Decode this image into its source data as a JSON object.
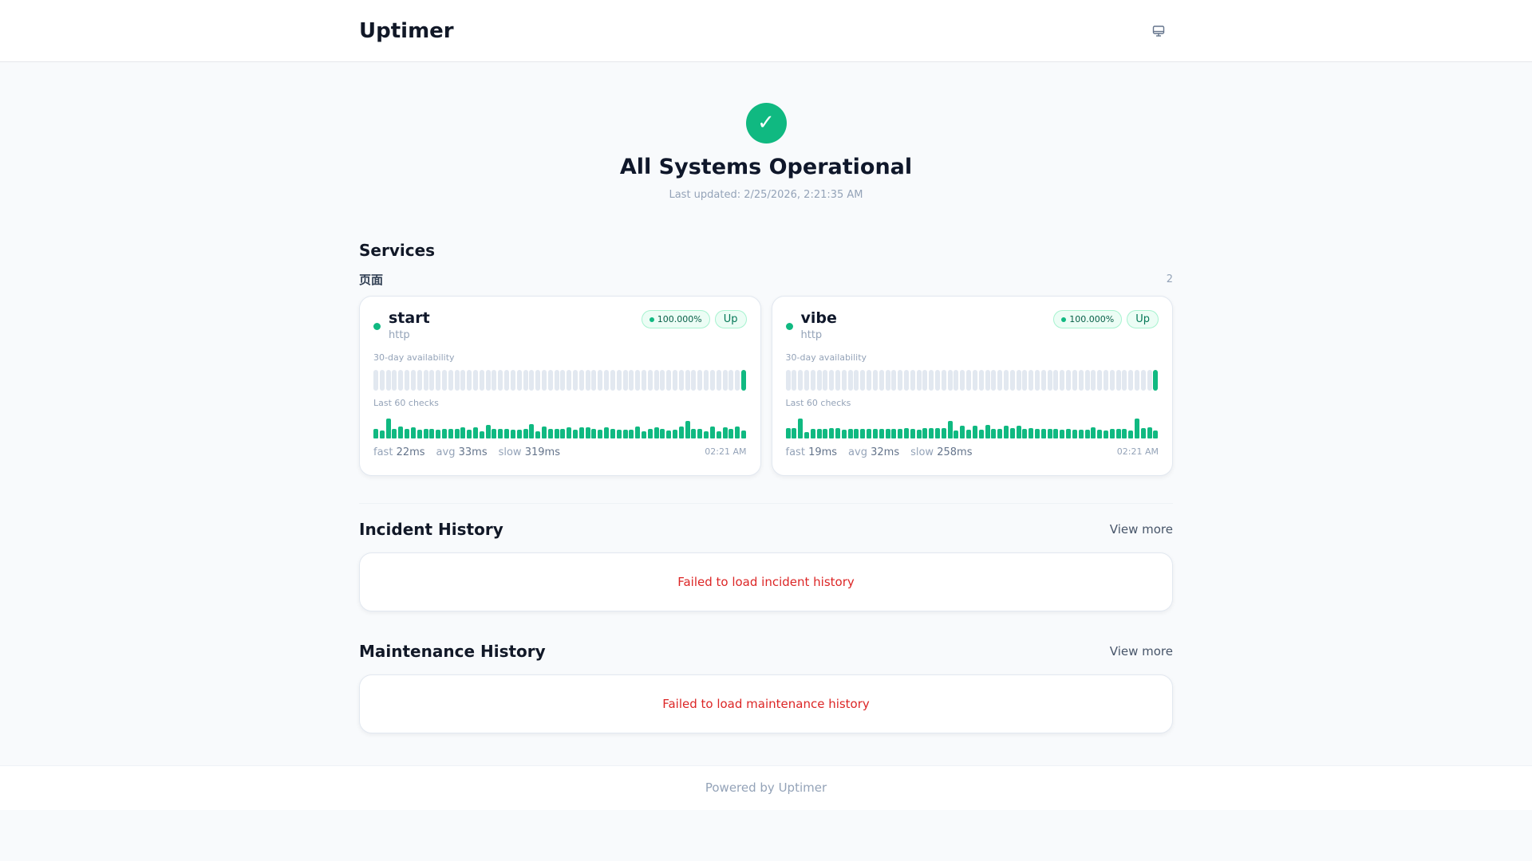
{
  "header": {
    "title": "Uptimer",
    "theme_icon": "monitor-icon"
  },
  "hero": {
    "icon": "✓",
    "title": "All Systems Operational",
    "updated": "Last updated: 2/25/2026, 2:21:35 AM"
  },
  "services": {
    "title": "Services",
    "group": {
      "name": "页面",
      "count": "2"
    },
    "cards": [
      {
        "name": "start",
        "type": "http",
        "uptime": "100.000%",
        "status": "Up",
        "avail_label": "30-day availability",
        "checks_label": "Last 60 checks",
        "availability": [
          0,
          0,
          0,
          0,
          0,
          0,
          0,
          0,
          0,
          0,
          0,
          0,
          0,
          0,
          0,
          0,
          0,
          0,
          0,
          0,
          0,
          0,
          0,
          0,
          0,
          0,
          0,
          0,
          0,
          0,
          0,
          0,
          0,
          0,
          0,
          0,
          0,
          0,
          0,
          0,
          0,
          0,
          0,
          0,
          0,
          0,
          0,
          0,
          0,
          0,
          0,
          0,
          0,
          0,
          0,
          0,
          0,
          0,
          0,
          1
        ],
        "latency": [
          30,
          23,
          60,
          30,
          35,
          30,
          33,
          27,
          30,
          30,
          27,
          30,
          28,
          28,
          33,
          27,
          33,
          22,
          42,
          28,
          30,
          28,
          27,
          27,
          30,
          44,
          22,
          37,
          30,
          30,
          28,
          33,
          27,
          33,
          33,
          28,
          27,
          33,
          28,
          27,
          27,
          27,
          37,
          22,
          28,
          33,
          28,
          25,
          27,
          35,
          53,
          28,
          30,
          22,
          35,
          22,
          33,
          28,
          35,
          23
        ],
        "fast_label": "fast",
        "fast": "22ms",
        "avg_label": "avg",
        "avg": "33ms",
        "slow_label": "slow",
        "slow": "319ms",
        "time": "02:21 AM"
      },
      {
        "name": "vibe",
        "type": "http",
        "uptime": "100.000%",
        "status": "Up",
        "avail_label": "30-day availability",
        "checks_label": "Last 60 checks",
        "availability": [
          0,
          0,
          0,
          0,
          0,
          0,
          0,
          0,
          0,
          0,
          0,
          0,
          0,
          0,
          0,
          0,
          0,
          0,
          0,
          0,
          0,
          0,
          0,
          0,
          0,
          0,
          0,
          0,
          0,
          0,
          0,
          0,
          0,
          0,
          0,
          0,
          0,
          0,
          0,
          0,
          0,
          0,
          0,
          0,
          0,
          0,
          0,
          0,
          0,
          0,
          0,
          0,
          0,
          0,
          0,
          0,
          0,
          0,
          0,
          1
        ],
        "latency": [
          26,
          26,
          50,
          17,
          24,
          24,
          24,
          26,
          26,
          22,
          24,
          24,
          24,
          24,
          24,
          24,
          24,
          24,
          24,
          26,
          24,
          22,
          26,
          26,
          26,
          26,
          44,
          20,
          32,
          22,
          32,
          22,
          34,
          24,
          24,
          32,
          26,
          32,
          24,
          26,
          24,
          24,
          24,
          24,
          22,
          24,
          22,
          22,
          22,
          28,
          22,
          20,
          24,
          24,
          24,
          20,
          50,
          26,
          28,
          20
        ],
        "fast_label": "fast",
        "fast": "19ms",
        "avg_label": "avg",
        "avg": "32ms",
        "slow_label": "slow",
        "slow": "258ms",
        "time": "02:21 AM"
      }
    ]
  },
  "incidents": {
    "title": "Incident History",
    "more": "View more",
    "error": "Failed to load incident history"
  },
  "maintenance": {
    "title": "Maintenance History",
    "more": "View more",
    "error": "Failed to load maintenance history"
  },
  "footer": {
    "text": "Powered by Uptimer"
  },
  "colors": {
    "up": "#10b981",
    "empty": "#e2e8f0",
    "error": "#dc2626"
  }
}
